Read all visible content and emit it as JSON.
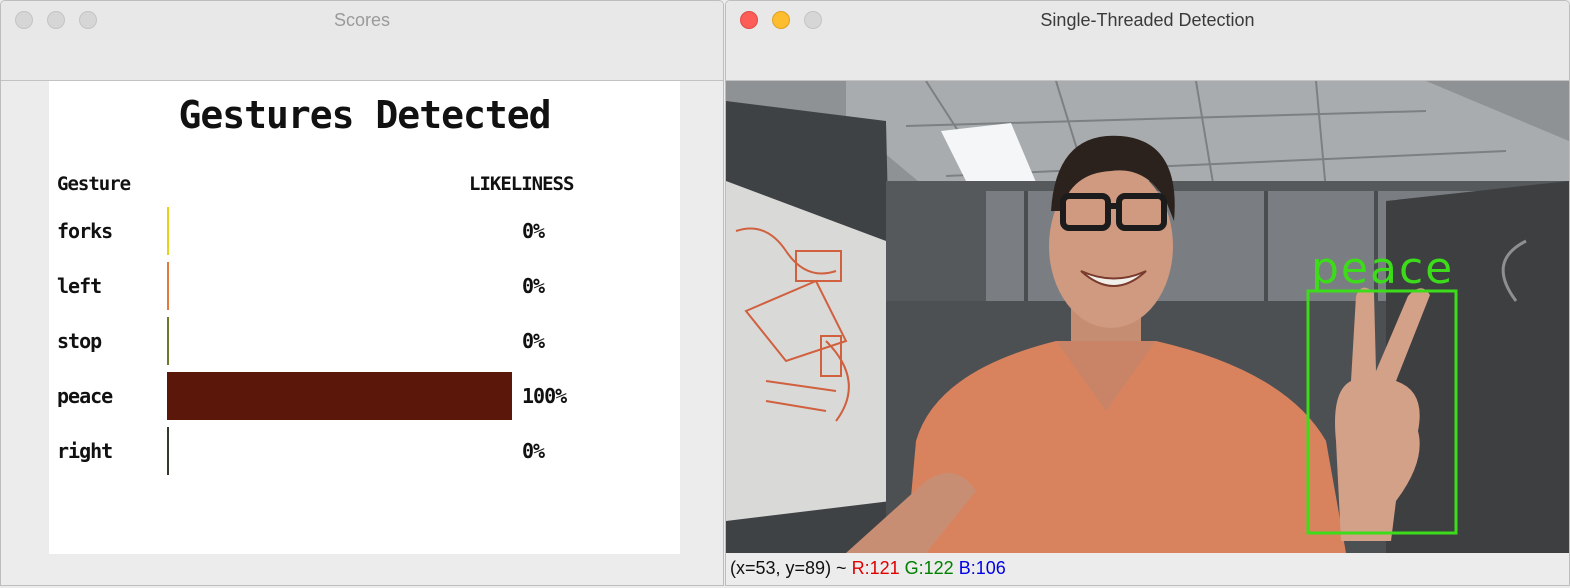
{
  "scores_window": {
    "title": "Scores",
    "heading": "Gestures Detected",
    "col_gesture": "Gesture",
    "col_likeliness": "LIKELINESS",
    "rows": [
      {
        "name": "forks",
        "pct_text": "0%",
        "value": 0,
        "color": "#e6d21a"
      },
      {
        "name": "left",
        "pct_text": "0%",
        "value": 0,
        "color": "#e07a3a"
      },
      {
        "name": "stop",
        "pct_text": "0%",
        "value": 0,
        "color": "#6a7a2a"
      },
      {
        "name": "peace",
        "pct_text": "100%",
        "value": 100,
        "color": "#5a170a"
      },
      {
        "name": "right",
        "pct_text": "0%",
        "value": 0,
        "color": "#2f3a2a"
      }
    ]
  },
  "detect_window": {
    "title": "Single-Threaded Detection",
    "detection_label": "peace",
    "detection_color": "#3ddc1a",
    "status": {
      "coords": "(x=53, y=89) ~",
      "r_label": "R:121",
      "g_label": "G:122",
      "b_label": "B:106"
    }
  }
}
